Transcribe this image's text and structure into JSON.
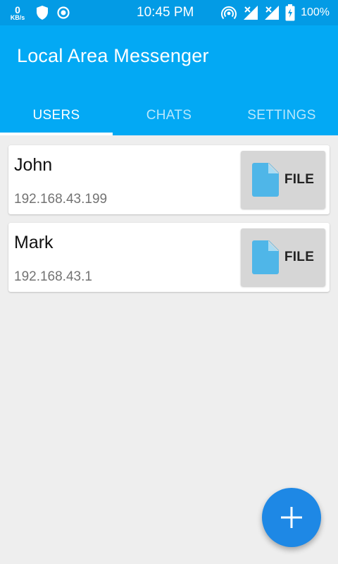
{
  "status_bar": {
    "net_speed_value": "0",
    "net_speed_unit": "KB/s",
    "time": "10:45 PM",
    "battery_percent": "100%",
    "icons": [
      "shield-icon",
      "record-icon",
      "hotspot-icon",
      "signal-icon",
      "signal-icon",
      "battery-charging-icon"
    ]
  },
  "app_bar": {
    "title": "Local Area Messenger",
    "tabs": [
      {
        "label": "USERS",
        "active": true
      },
      {
        "label": "CHATS",
        "active": false
      },
      {
        "label": "SETTINGS",
        "active": false
      }
    ]
  },
  "users": [
    {
      "name": "John",
      "ip": "192.168.43.199",
      "file_label": "FILE"
    },
    {
      "name": "Mark",
      "ip": "192.168.43.1",
      "file_label": "FILE"
    }
  ],
  "fab": {
    "icon": "plus-icon"
  },
  "colors": {
    "status_bar": "#039be5",
    "app_bar": "#03a9f4",
    "fab": "#1e88e5",
    "file_icon": "#4fb6e8",
    "background": "#eeeeee"
  }
}
